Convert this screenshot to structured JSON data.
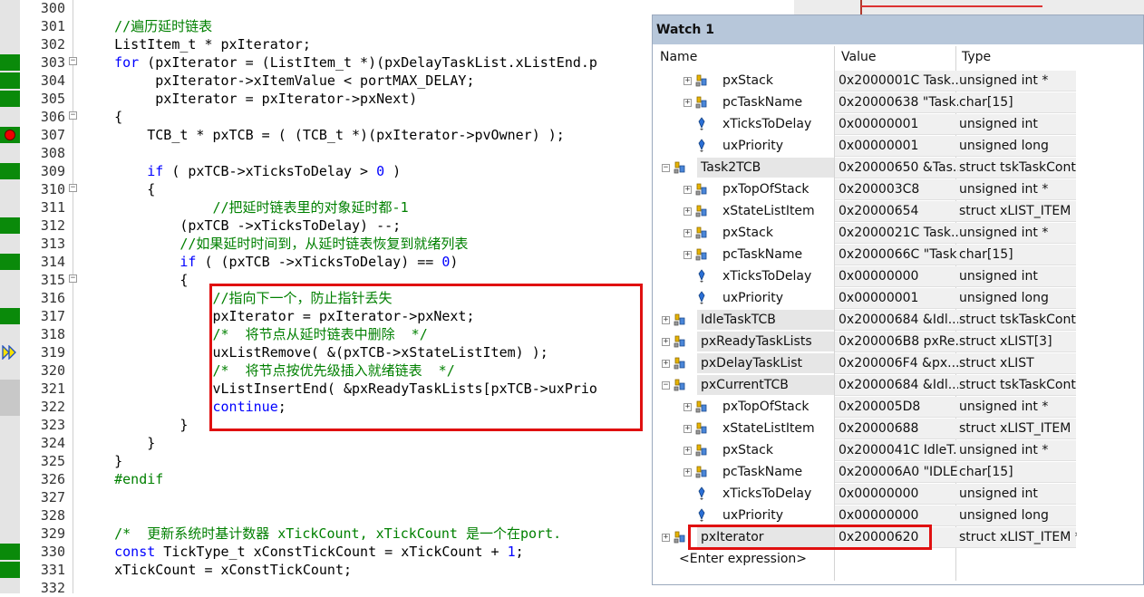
{
  "editor": {
    "lines": [
      {
        "num": "300",
        "segs": []
      },
      {
        "num": "301",
        "segs": [
          {
            "t": "    //遍历延时链表",
            "c": "cmt"
          }
        ]
      },
      {
        "num": "302",
        "segs": [
          {
            "t": "    ListItem_t * pxIterator;",
            "c": ""
          }
        ]
      },
      {
        "num": "303",
        "fold": "−",
        "segs": [
          {
            "t": "    ",
            "c": ""
          },
          {
            "t": "for",
            "c": "kw"
          },
          {
            "t": " (pxIterator = (ListItem_t *)(pxDelayTaskList.xListEnd.p",
            "c": ""
          }
        ]
      },
      {
        "num": "304",
        "segs": [
          {
            "t": "         pxIterator->xItemValue < portMAX_DELAY;",
            "c": ""
          }
        ]
      },
      {
        "num": "305",
        "segs": [
          {
            "t": "         pxIterator = pxIterator->pxNext)",
            "c": ""
          }
        ]
      },
      {
        "num": "306",
        "fold": "−",
        "segs": [
          {
            "t": "    {",
            "c": ""
          }
        ]
      },
      {
        "num": "307",
        "segs": [
          {
            "t": "        TCB_t * pxTCB = ( (TCB_t *)(pxIterator->pvOwner) );",
            "c": ""
          }
        ]
      },
      {
        "num": "308",
        "segs": []
      },
      {
        "num": "309",
        "segs": [
          {
            "t": "        ",
            "c": ""
          },
          {
            "t": "if",
            "c": "kw"
          },
          {
            "t": " ( pxTCB->xTicksToDelay > ",
            "c": ""
          },
          {
            "t": "0",
            "c": "kw"
          },
          {
            "t": " )",
            "c": ""
          }
        ]
      },
      {
        "num": "310",
        "fold": "−",
        "segs": [
          {
            "t": "        {",
            "c": ""
          }
        ]
      },
      {
        "num": "311",
        "segs": [
          {
            "t": "                //把延时链表里的对象延时都-1",
            "c": "cmt"
          }
        ]
      },
      {
        "num": "312",
        "segs": [
          {
            "t": "            (pxTCB ->xTicksToDelay) --;",
            "c": ""
          }
        ]
      },
      {
        "num": "313",
        "segs": [
          {
            "t": "            //如果延时时间到，从延时链表恢复到就绪列表",
            "c": "cmt"
          }
        ]
      },
      {
        "num": "314",
        "segs": [
          {
            "t": "            ",
            "c": ""
          },
          {
            "t": "if",
            "c": "kw"
          },
          {
            "t": " ( (pxTCB ->xTicksToDelay) == ",
            "c": ""
          },
          {
            "t": "0",
            "c": "kw"
          },
          {
            "t": ")",
            "c": ""
          }
        ]
      },
      {
        "num": "315",
        "fold": "−",
        "segs": [
          {
            "t": "            {",
            "c": ""
          }
        ]
      },
      {
        "num": "316",
        "segs": [
          {
            "t": "                //指向下一个，防止指针丢失",
            "c": "cmt"
          }
        ]
      },
      {
        "num": "317",
        "segs": [
          {
            "t": "                pxIterator = pxIterator->pxNext;",
            "c": ""
          }
        ]
      },
      {
        "num": "318",
        "segs": [
          {
            "t": "                /*  将节点从延时链表中删除  */",
            "c": "cmt"
          }
        ]
      },
      {
        "num": "319",
        "segs": [
          {
            "t": "                uxListRemove( &(pxTCB->xStateListItem) );",
            "c": ""
          }
        ]
      },
      {
        "num": "320",
        "segs": [
          {
            "t": "                /*  将节点按优先级插入就绪链表  */",
            "c": "cmt"
          }
        ]
      },
      {
        "num": "321",
        "segs": [
          {
            "t": "                vListInsertEnd( &pxReadyTaskLists[pxTCB->uxPrio",
            "c": ""
          }
        ]
      },
      {
        "num": "322",
        "segs": [
          {
            "t": "                ",
            "c": ""
          },
          {
            "t": "continue",
            "c": "kw"
          },
          {
            "t": ";",
            "c": ""
          }
        ]
      },
      {
        "num": "323",
        "segs": [
          {
            "t": "            }",
            "c": ""
          }
        ]
      },
      {
        "num": "324",
        "segs": [
          {
            "t": "        }",
            "c": ""
          }
        ]
      },
      {
        "num": "325",
        "segs": [
          {
            "t": "    }",
            "c": ""
          }
        ]
      },
      {
        "num": "326",
        "segs": [
          {
            "t": "    #endif",
            "c": "cmt"
          }
        ]
      },
      {
        "num": "327",
        "segs": []
      },
      {
        "num": "328",
        "segs": []
      },
      {
        "num": "329",
        "segs": [
          {
            "t": "    /*  更新系统时基计数器 xTickCount, xTickCount 是一个在port.",
            "c": "cmt"
          }
        ]
      },
      {
        "num": "330",
        "segs": [
          {
            "t": "    ",
            "c": ""
          },
          {
            "t": "const",
            "c": "kw"
          },
          {
            "t": " TickType_t xConstTickCount = xTickCount + ",
            "c": ""
          },
          {
            "t": "1",
            "c": "kw"
          },
          {
            "t": ";",
            "c": ""
          }
        ]
      },
      {
        "num": "331",
        "segs": [
          {
            "t": "    xTickCount = xConstTickCount;",
            "c": ""
          }
        ]
      },
      {
        "num": "332",
        "segs": []
      }
    ],
    "marks": {
      "green": [
        "303",
        "304",
        "305",
        "309",
        "312",
        "314",
        "317",
        "330",
        "331"
      ],
      "gray": [
        "321",
        "322"
      ],
      "breakpoint": "307",
      "current": "319"
    },
    "colors": {
      "green": "#0a8a0a",
      "comment": "#008000",
      "keyword": "#0000ff",
      "highlight_box": "#e01010"
    }
  },
  "watch": {
    "title": "Watch 1",
    "headers": {
      "name": "Name",
      "value": "Value",
      "type": "Type"
    },
    "rows": [
      {
        "indent": 1,
        "icon": "struct",
        "exp": "+",
        "name": "pxStack",
        "value": "0x2000001C Task...",
        "type": "unsigned int *"
      },
      {
        "indent": 1,
        "icon": "struct",
        "exp": "+",
        "name": "pcTaskName",
        "value": "0x20000638 \"Task...",
        "type": "char[15]"
      },
      {
        "indent": 1,
        "icon": "field",
        "name": "xTicksToDelay",
        "value": "0x00000001",
        "type": "unsigned int"
      },
      {
        "indent": 1,
        "icon": "field",
        "name": "uxPriority",
        "value": "0x00000001",
        "type": "unsigned long"
      },
      {
        "indent": 0,
        "icon": "struct",
        "exp": "−",
        "name": "Task2TCB",
        "value": "0x20000650 &Tas...",
        "type": "struct tskTaskCont..."
      },
      {
        "indent": 1,
        "icon": "struct",
        "exp": "+",
        "name": "pxTopOfStack",
        "value": "0x200003C8",
        "type": "unsigned int *"
      },
      {
        "indent": 1,
        "icon": "struct",
        "exp": "+",
        "name": "xStateListItem",
        "value": "0x20000654",
        "type": "struct xLIST_ITEM"
      },
      {
        "indent": 1,
        "icon": "struct",
        "exp": "+",
        "name": "pxStack",
        "value": "0x2000021C Task...",
        "type": "unsigned int *"
      },
      {
        "indent": 1,
        "icon": "struct",
        "exp": "+",
        "name": "pcTaskName",
        "value": "0x2000066C \"Task...",
        "type": "char[15]"
      },
      {
        "indent": 1,
        "icon": "field",
        "name": "xTicksToDelay",
        "value": "0x00000000",
        "type": "unsigned int"
      },
      {
        "indent": 1,
        "icon": "field",
        "name": "uxPriority",
        "value": "0x00000001",
        "type": "unsigned long"
      },
      {
        "indent": 0,
        "icon": "struct",
        "exp": "+",
        "name": "IdleTaskTCB",
        "value": "0x20000684 &Idl...",
        "type": "struct tskTaskCont..."
      },
      {
        "indent": 0,
        "icon": "struct",
        "exp": "+",
        "name": "pxReadyTaskLists",
        "value": "0x200006B8 pxRe...",
        "type": "struct xLIST[3]"
      },
      {
        "indent": 0,
        "icon": "struct",
        "exp": "+",
        "name": "pxDelayTaskList",
        "value": "0x200006F4 &px...",
        "type": "struct xLIST"
      },
      {
        "indent": 0,
        "icon": "struct",
        "exp": "−",
        "name": "pxCurrentTCB",
        "value": "0x20000684 &Idl...",
        "type": "struct tskTaskCont..."
      },
      {
        "indent": 1,
        "icon": "struct",
        "exp": "+",
        "name": "pxTopOfStack",
        "value": "0x200005D8",
        "type": "unsigned int *"
      },
      {
        "indent": 1,
        "icon": "struct",
        "exp": "+",
        "name": "xStateListItem",
        "value": "0x20000688",
        "type": "struct xLIST_ITEM"
      },
      {
        "indent": 1,
        "icon": "struct",
        "exp": "+",
        "name": "pxStack",
        "value": "0x2000041C IdleT...",
        "type": "unsigned int *"
      },
      {
        "indent": 1,
        "icon": "struct",
        "exp": "+",
        "name": "pcTaskName",
        "value": "0x200006A0 \"IDLE\"",
        "type": "char[15]"
      },
      {
        "indent": 1,
        "icon": "field",
        "name": "xTicksToDelay",
        "value": "0x00000000",
        "type": "unsigned int"
      },
      {
        "indent": 1,
        "icon": "field",
        "name": "uxPriority",
        "value": "0x00000000",
        "type": "unsigned long"
      },
      {
        "indent": 0,
        "icon": "struct",
        "exp": "+",
        "name": "pxIterator",
        "value": "0x20000620",
        "type": "struct xLIST_ITEM *"
      }
    ],
    "enter_expression": "<Enter expression>"
  }
}
